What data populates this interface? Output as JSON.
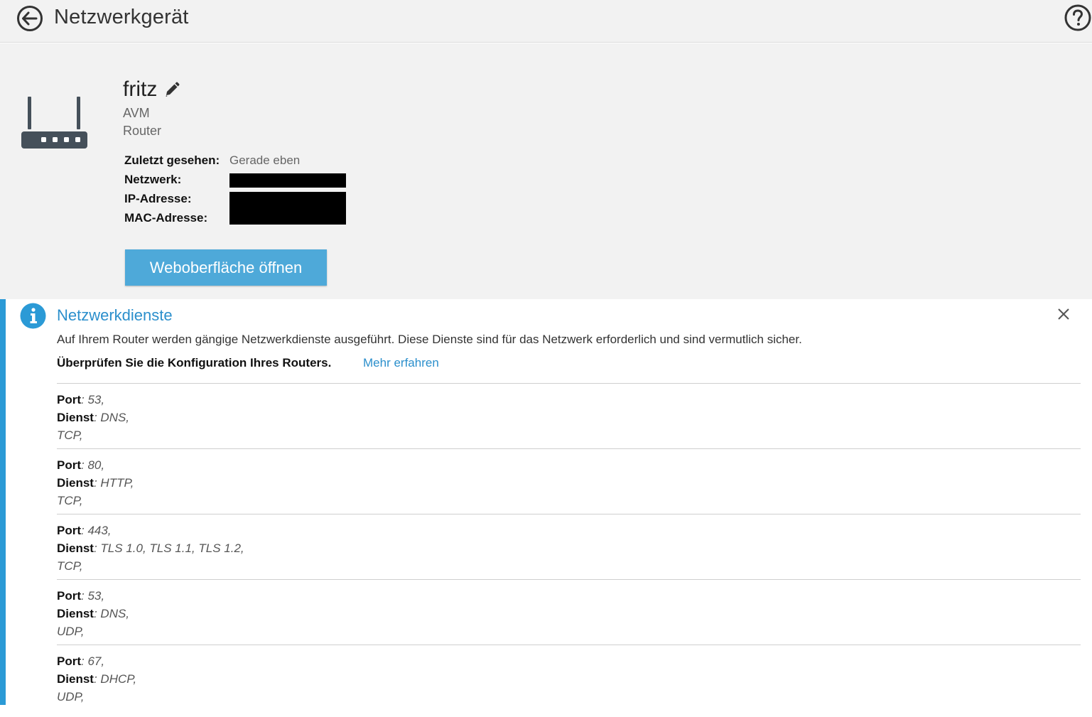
{
  "header": {
    "title": "Netzwerkgerät"
  },
  "device": {
    "name": "fritz",
    "vendor": "AVM",
    "type": "Router",
    "details": {
      "last_seen_label": "Zuletzt gesehen:",
      "last_seen_value": "Gerade eben",
      "network_label": "Netzwerk:",
      "ip_label": "IP-Adresse:",
      "mac_label": "MAC-Adresse:"
    },
    "open_web_button": "Weboberfläche öffnen"
  },
  "services": {
    "title": "Netzwerkdienste",
    "description": "Auf Ihrem Router werden gängige Netzwerkdienste ausgeführt. Diese Dienste sind für das Netzwerk erforderlich und sind vermutlich sicher.",
    "check_text": "Überprüfen Sie die Konfiguration Ihres Routers.",
    "more_link": "Mehr erfahren",
    "port_key": "Port",
    "service_key": "Dienst",
    "items": [
      {
        "port": ": 53,",
        "service": ": DNS,",
        "protocol": "TCP,"
      },
      {
        "port": ": 80,",
        "service": ": HTTP,",
        "protocol": "TCP,"
      },
      {
        "port": ": 443,",
        "service": ": TLS 1.0, TLS 1.1, TLS 1.2,",
        "protocol": "TCP,"
      },
      {
        "port": ": 53,",
        "service": ": DNS,",
        "protocol": "UDP,"
      },
      {
        "port": ": 67,",
        "service": ": DHCP,",
        "protocol": "UDP,"
      }
    ]
  },
  "colors": {
    "accent": "#2b9ad6",
    "button": "#4ea9d9",
    "link": "#2b8fcc",
    "panel_bg": "#f2f2f2"
  },
  "icons": [
    "back-arrow-icon",
    "help-icon",
    "router-icon",
    "pencil-icon",
    "info-icon",
    "close-icon"
  ]
}
